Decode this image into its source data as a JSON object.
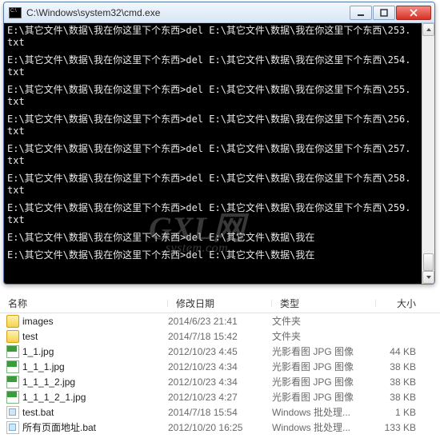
{
  "cmd": {
    "title": "C:\\Windows\\system32\\cmd.exe",
    "prompt_path": "E:\\其它文件\\数据\\我在你这里下个东西>",
    "del_cmd": "del E:\\其它文件\\数据\\我在你这里下个东西\\",
    "del_cmd_short": "del E:\\其它文件\\数据\\我在",
    "targets": [
      "253.",
      "254.",
      "255.",
      "256.",
      "257.",
      "258.",
      "259."
    ],
    "ext_line": "txt"
  },
  "explorer": {
    "columns": {
      "name": "名称",
      "date": "修改日期",
      "type": "类型",
      "size": "大小"
    },
    "rows": [
      {
        "icon": "folder",
        "name": "images",
        "date": "2014/6/23 21:41",
        "type": "文件夹",
        "size": ""
      },
      {
        "icon": "folder",
        "name": "test",
        "date": "2014/7/18 15:42",
        "type": "文件夹",
        "size": ""
      },
      {
        "icon": "jpg",
        "name": "1_1.jpg",
        "date": "2012/10/23 4:45",
        "type": "光影看图 JPG 图像",
        "size": "44 KB"
      },
      {
        "icon": "jpg",
        "name": "1_1_1.jpg",
        "date": "2012/10/23 4:34",
        "type": "光影看图 JPG 图像",
        "size": "38 KB"
      },
      {
        "icon": "jpg",
        "name": "1_1_1_2.jpg",
        "date": "2012/10/23 4:34",
        "type": "光影看图 JPG 图像",
        "size": "38 KB"
      },
      {
        "icon": "jpg",
        "name": "1_1_1_2_1.jpg",
        "date": "2012/10/23 4:27",
        "type": "光影看图 JPG 图像",
        "size": "38 KB"
      },
      {
        "icon": "bat",
        "name": "test.bat",
        "date": "2014/7/18 15:54",
        "type": "Windows 批处理...",
        "size": "1 KB"
      },
      {
        "icon": "bat",
        "name": "所有页面地址.bat",
        "date": "2012/10/20 16:25",
        "type": "Windows 批处理...",
        "size": "133 KB"
      }
    ]
  },
  "watermark": {
    "line1": "GXL网",
    "line2": "system.com"
  }
}
